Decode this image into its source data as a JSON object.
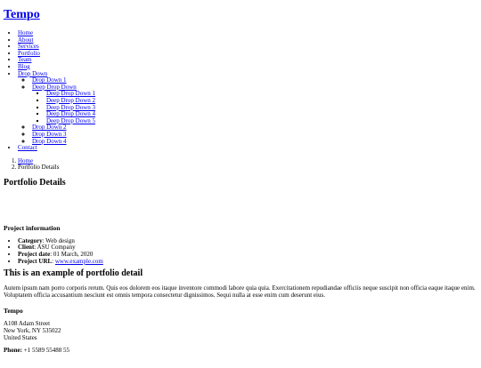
{
  "header": {
    "brand": "Tempo"
  },
  "nav": {
    "items": [
      {
        "label": "Home"
      },
      {
        "label": "About"
      },
      {
        "label": "Services"
      },
      {
        "label": "Portfolio"
      },
      {
        "label": "Team"
      },
      {
        "label": "Blog"
      },
      {
        "label": "Drop Down"
      },
      {
        "label": "Contact"
      }
    ],
    "dropdown": [
      {
        "label": "Drop Down 1"
      },
      {
        "label": "Deep Drop Down"
      },
      {
        "label": "Drop Down 2"
      },
      {
        "label": "Drop Down 3"
      },
      {
        "label": "Drop Down 4"
      }
    ],
    "deep_dropdown": [
      {
        "label": "Deep Drop Down 1"
      },
      {
        "label": "Deep Drop Down 2"
      },
      {
        "label": "Deep Drop Down 3"
      },
      {
        "label": "Deep Drop Down 4"
      },
      {
        "label": "Deep Drop Down 5"
      }
    ]
  },
  "breadcrumbs": [
    {
      "label": "Home"
    },
    {
      "label": "Portfolio Details"
    }
  ],
  "section_title": "Portfolio Details",
  "project_info": {
    "title": "Project information",
    "items": [
      {
        "label": "Category",
        "value": ": Web design"
      },
      {
        "label": "Client",
        "value": ": ASU Company"
      },
      {
        "label": "Project date",
        "value": ": 01 March, 2020"
      },
      {
        "label": "Project URL",
        "value": ": ",
        "link": "www.example.com"
      }
    ]
  },
  "detail": {
    "title": "This is an example of portfolio detail",
    "description": "Autem ipsum nam porro corporis rerum. Quis eos dolorem eos itaque inventore commodi labore quia quia. Exercitationem repudiandae officiis neque suscipit non officia eaque itaque enim. Voluptatem officia accusantium nesciunt est omnis tempora consectetur dignissimos. Sequi nulla at esse enim cum deserunt eius."
  },
  "footer": {
    "brand": "Tempo",
    "address_line1": "A108 Adam Street",
    "address_line2": "New York, NY 535022",
    "address_line3": "United States",
    "phone_label": "Phone:",
    "phone_value": " +1 5589 55488 55"
  }
}
